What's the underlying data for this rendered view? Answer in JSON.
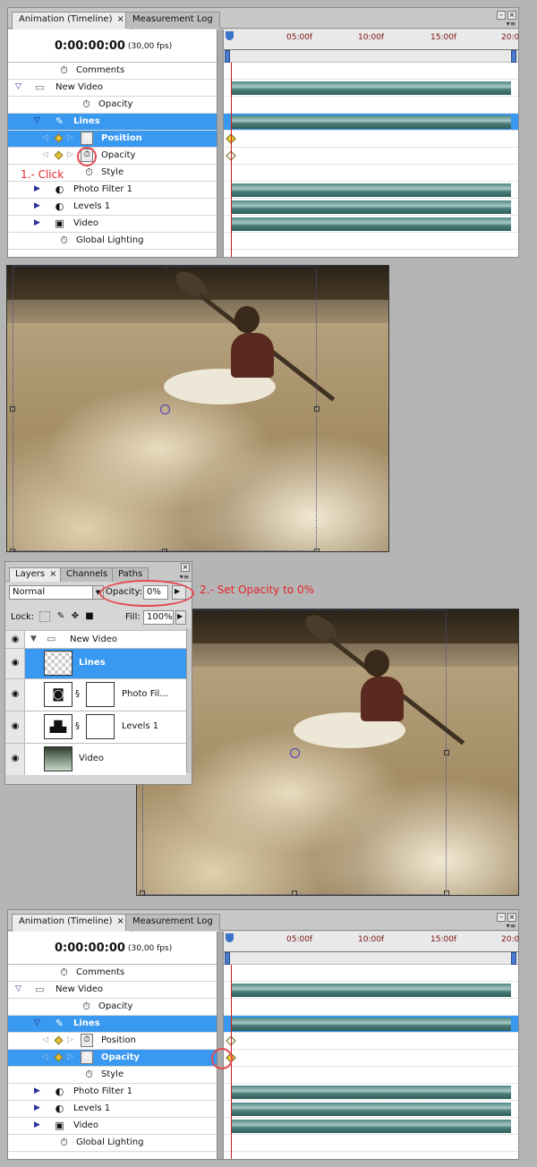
{
  "timeline_top": {
    "tabs": [
      "Animation (Timeline)",
      "Measurement Log"
    ],
    "close_glyph": "×",
    "timecode": "0:00:00:00",
    "fps": "(30,00 fps)",
    "ruler_ticks": [
      "05:00f",
      "10:00f",
      "15:00f",
      "20:0"
    ],
    "rows": [
      {
        "label": "Comments"
      },
      {
        "label": "New Video"
      },
      {
        "label": "Opacity"
      },
      {
        "label": "Lines"
      },
      {
        "label": "Position"
      },
      {
        "label": "Opacity"
      },
      {
        "label": "Style"
      },
      {
        "label": "Photo Filter 1"
      },
      {
        "label": "Levels 1"
      },
      {
        "label": "Video"
      },
      {
        "label": "Global Lighting"
      }
    ]
  },
  "annotations": {
    "step1": "1.- Click",
    "step2": "2.- Set Opacity to 0%"
  },
  "layers_panel": {
    "tabs": [
      "Layers",
      "Channels",
      "Paths"
    ],
    "close_glyph": "×",
    "blend_mode": "Normal",
    "opacity_label": "Opacity:",
    "opacity_value": "0%",
    "lock_label": "Lock:",
    "fill_label": "Fill:",
    "fill_value": "100%",
    "group_name": "New Video",
    "layers": [
      {
        "name": "Lines",
        "selected": true
      },
      {
        "name": "Photo Fil..."
      },
      {
        "name": "Levels 1"
      },
      {
        "name": "Video"
      }
    ]
  },
  "timeline_bottom": {
    "tabs": [
      "Animation (Timeline)",
      "Measurement Log"
    ],
    "close_glyph": "×",
    "timecode": "0:00:00:00",
    "fps": "(30,00 fps)",
    "ruler_ticks": [
      "05:00f",
      "10:00f",
      "15:00f",
      "20:0"
    ],
    "rows": [
      {
        "label": "Comments"
      },
      {
        "label": "New Video"
      },
      {
        "label": "Opacity"
      },
      {
        "label": "Lines"
      },
      {
        "label": "Position"
      },
      {
        "label": "Opacity"
      },
      {
        "label": "Style"
      },
      {
        "label": "Photo Filter 1"
      },
      {
        "label": "Levels 1"
      },
      {
        "label": "Video"
      },
      {
        "label": "Global Lighting"
      }
    ]
  },
  "colors": {
    "selection_blue": "#3999f0",
    "track_bar": "#4f8683",
    "annotation_red": "#e3242b",
    "keyframe_yellow": "#f1d135"
  }
}
